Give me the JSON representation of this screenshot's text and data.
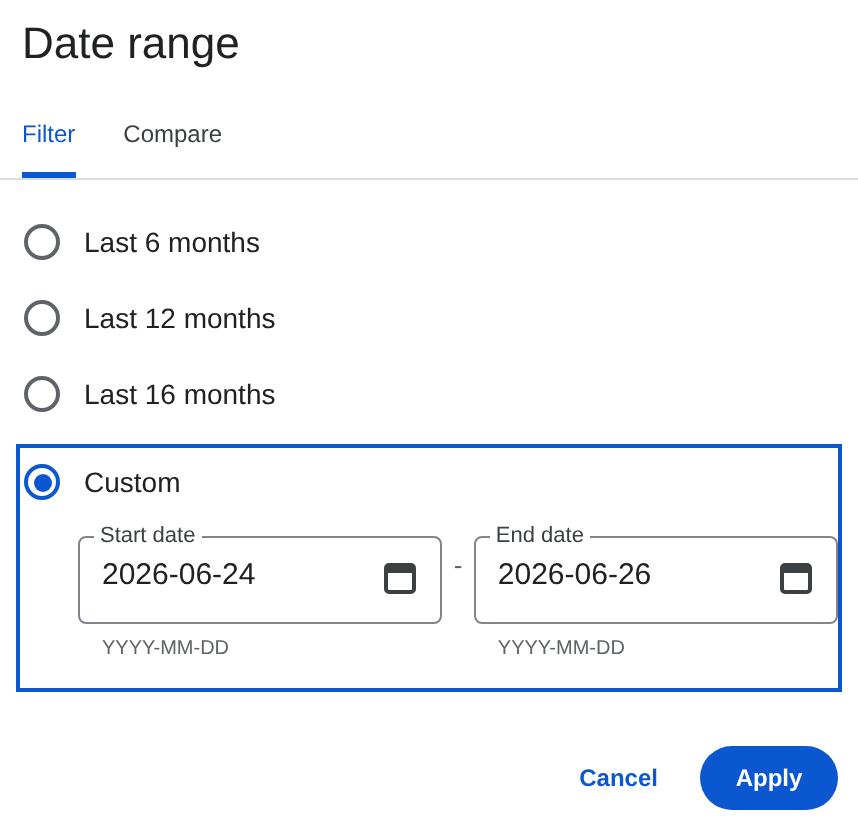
{
  "dialog": {
    "title": "Date range"
  },
  "tabs": [
    {
      "label": "Filter",
      "selected": true
    },
    {
      "label": "Compare",
      "selected": false
    }
  ],
  "options": [
    {
      "label": "Last 6 months",
      "selected": false
    },
    {
      "label": "Last 12 months",
      "selected": false
    },
    {
      "label": "Last 16 months",
      "selected": false
    },
    {
      "label": "Custom",
      "selected": true,
      "start": {
        "label": "Start date",
        "value": "2026-06-24",
        "hint": "YYYY-MM-DD"
      },
      "separator": "-",
      "end": {
        "label": "End date",
        "value": "2026-06-26",
        "hint": "YYYY-MM-DD"
      }
    }
  ],
  "actions": {
    "cancel": "Cancel",
    "apply": "Apply"
  }
}
